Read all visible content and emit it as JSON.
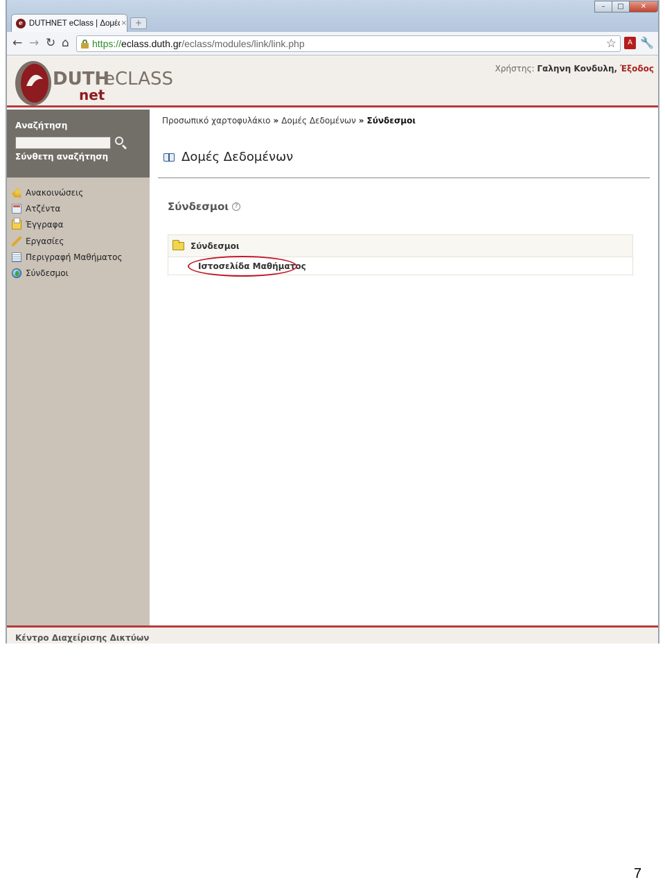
{
  "browser": {
    "tab_title": "DUTHNET eClass | Δομές Δ",
    "tab_close": "×",
    "new_tab": "+",
    "url_proto": "https://",
    "url_domain": "eclass.duth.gr",
    "url_path": "/eclass/modules/link/link.php",
    "window_controls": [
      "–",
      "□",
      "✕"
    ]
  },
  "header": {
    "logo_duth": "DUTH",
    "logo_eclass": "eCLASS",
    "logo_net": "net",
    "user_label": "Χρήστης:",
    "user_name": "Γαληνη Κονδυλη,",
    "logout": "Έξοδος"
  },
  "sidebar": {
    "search_title": "Αναζήτηση",
    "search_value": "",
    "advanced_search": "Σύνθετη αναζήτηση",
    "items": [
      {
        "label": "Ανακοινώσεις",
        "icon": "announcement-icon"
      },
      {
        "label": "Ατζέντα",
        "icon": "calendar-icon"
      },
      {
        "label": "Έγγραφα",
        "icon": "documents-icon"
      },
      {
        "label": "Εργασίες",
        "icon": "pencil-icon"
      },
      {
        "label": "Περιγραφή Μαθήματος",
        "icon": "description-icon"
      },
      {
        "label": "Σύνδεσμοι",
        "icon": "globe-icon"
      }
    ]
  },
  "breadcrumb": {
    "items": [
      "Προσωπικό χαρτοφυλάκιο",
      "Δομές Δεδομένων"
    ],
    "current": "Σύνδεσμοι",
    "separator": "»"
  },
  "main": {
    "course_title": "Δομές Δεδομένων",
    "section_heading": "Σύνδεσμοι",
    "help": "?",
    "category": "Σύνδεσμοι",
    "link": "Ιστοσελίδα Μαθήματος"
  },
  "footer": {
    "text": "Κέντρο Διαχείρισης Δικτύων"
  },
  "document": {
    "page_number": "7"
  },
  "colors": {
    "accent_red": "#b53a3a",
    "sidebar_bg": "#cbc3b8",
    "search_bg": "#726f69",
    "annotation": "#c0182a"
  }
}
